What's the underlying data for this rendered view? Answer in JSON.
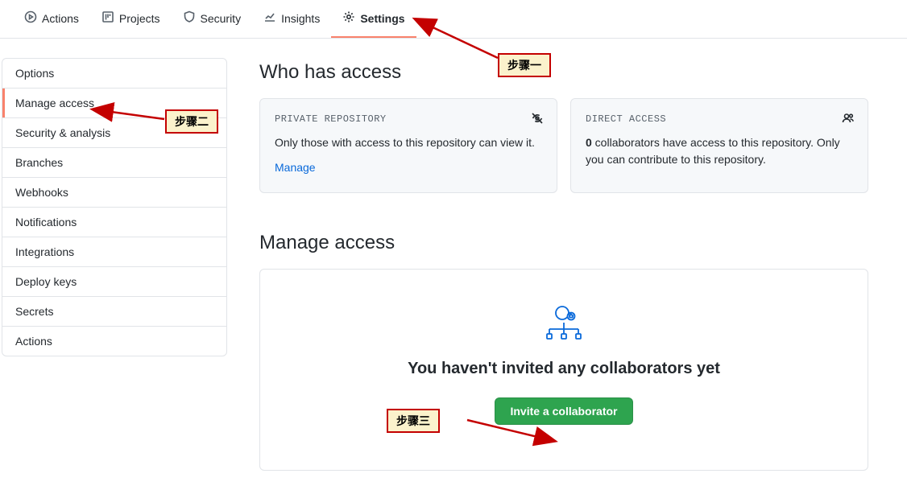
{
  "topnav": {
    "items": [
      {
        "label": "Actions"
      },
      {
        "label": "Projects"
      },
      {
        "label": "Security"
      },
      {
        "label": "Insights"
      },
      {
        "label": "Settings"
      }
    ],
    "active_index": 4
  },
  "sidebar": {
    "items": [
      {
        "label": "Options"
      },
      {
        "label": "Manage access"
      },
      {
        "label": "Security & analysis"
      },
      {
        "label": "Branches"
      },
      {
        "label": "Webhooks"
      },
      {
        "label": "Notifications"
      },
      {
        "label": "Integrations"
      },
      {
        "label": "Deploy keys"
      },
      {
        "label": "Secrets"
      },
      {
        "label": "Actions"
      }
    ],
    "active_index": 1
  },
  "access": {
    "title": "Who has access",
    "private_card": {
      "title": "PRIVATE REPOSITORY",
      "desc": "Only those with access to this repository can view it.",
      "link": "Manage"
    },
    "direct_card": {
      "title": "DIRECT ACCESS",
      "count_bold": "0",
      "desc_after": " collaborators have access to this repository. Only you can contribute to this repository."
    }
  },
  "manage": {
    "title": "Manage access",
    "blankslate": "You haven't invited any collaborators yet",
    "invite_button": "Invite a collaborator"
  },
  "annotations": {
    "step1": "步骤一",
    "step2": "步骤二",
    "step3": "步骤三"
  }
}
